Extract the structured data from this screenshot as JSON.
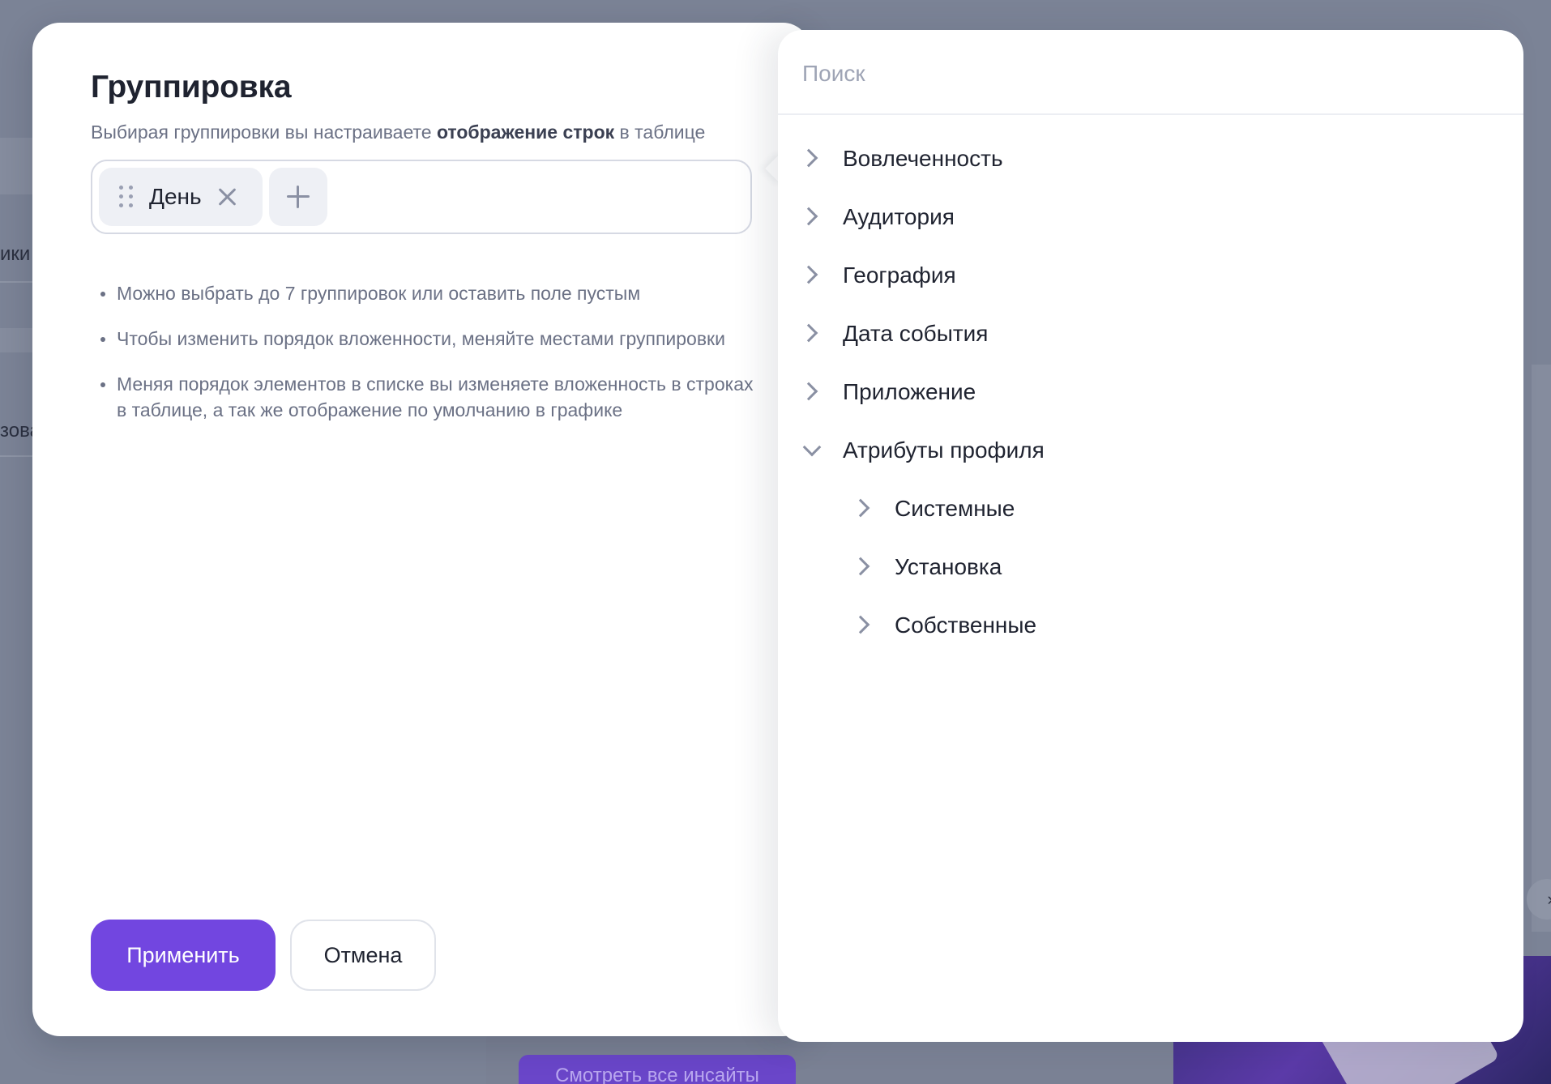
{
  "background": {
    "partial_labels": [
      "ики",
      "зова"
    ],
    "insights_button_label": "Смотреть все инсайты",
    "next_icon": "chevron-right-icon"
  },
  "modal": {
    "title": "Группировка",
    "subtitle_start": "Выбирая группировки вы настраиваете ",
    "subtitle_bold": "отображение строк",
    "subtitle_end": " в таблице",
    "chips": [
      {
        "label": "День",
        "handle_icon": "drag-handle-icon",
        "remove_icon": "close-icon"
      }
    ],
    "add_icon": "plus-icon",
    "hints": [
      "Можно выбрать до 7 группировок или оставить поле пустым",
      "Чтобы изменить порядок вложенности, меняйте местами группировки",
      "Меняя порядок элементов в списке вы изменяете вложенность в строках в таблице, а так же отображение по умолчанию в графике"
    ],
    "apply_label": "Применить",
    "cancel_label": "Отмена",
    "colors": {
      "accent": "#7246e0",
      "text": "#1f2330",
      "muted": "#6b7185"
    }
  },
  "panel": {
    "search_placeholder": "Поиск",
    "search_value": "",
    "tree": [
      {
        "label": "Вовлеченность",
        "level": 1,
        "expanded": false
      },
      {
        "label": "Аудитория",
        "level": 1,
        "expanded": false
      },
      {
        "label": "География",
        "level": 1,
        "expanded": false
      },
      {
        "label": "Дата события",
        "level": 1,
        "expanded": false
      },
      {
        "label": "Приложение",
        "level": 1,
        "expanded": false
      },
      {
        "label": "Атрибуты профиля",
        "level": 1,
        "expanded": true
      },
      {
        "label": "Системные",
        "level": 2,
        "expanded": false
      },
      {
        "label": "Установка",
        "level": 2,
        "expanded": false
      },
      {
        "label": "Собственные",
        "level": 2,
        "expanded": false
      }
    ]
  }
}
